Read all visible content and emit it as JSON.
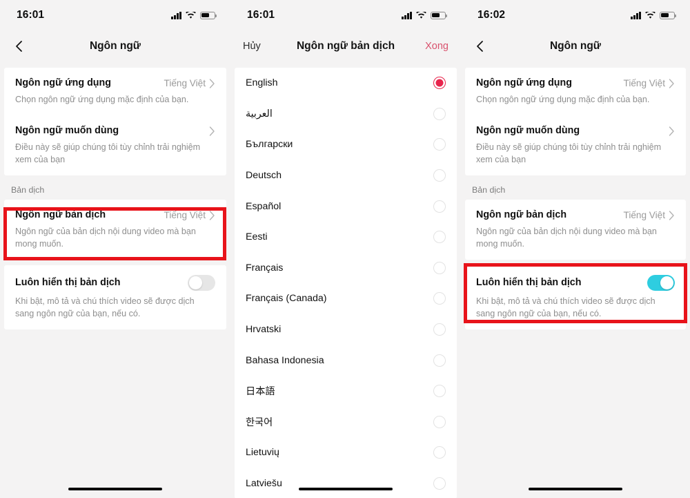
{
  "accent": {
    "red_highlight": "#e8131a",
    "selected_radio": "#e8244c",
    "done_button": "#d9536e",
    "toggle_on": "#2ecde0",
    "toggle_off": "#e6e6e6",
    "background": "#f4f3f3",
    "card": "#ffffff"
  },
  "panel1": {
    "status": {
      "time": "16:01",
      "signal_icon": "cellular-signal-icon",
      "wifi_icon": "wifi-icon",
      "battery_icon": "battery-icon"
    },
    "nav": {
      "back_icon": "chevron-left-icon",
      "title": "Ngôn ngữ"
    },
    "rows": [
      {
        "title": "Ngôn ngữ ứng dụng",
        "value": "Tiếng Việt",
        "desc": "Chọn ngôn ngữ ứng dụng mặc định của bạn.",
        "chevron": "chevron-right-icon"
      },
      {
        "title": "Ngôn ngữ muốn dùng",
        "value": "",
        "desc": "Điều này sẽ giúp chúng tôi tùy chỉnh trải nghiệm xem của bạn",
        "chevron": "chevron-right-icon"
      }
    ],
    "section_label": "Bản dịch",
    "translate_rows": [
      {
        "title": "Ngôn ngữ bản dịch",
        "value": "Tiếng Việt",
        "desc": "Ngôn ngữ của bản dịch nội dung video mà bạn mong muốn.",
        "chevron": "chevron-right-icon"
      }
    ],
    "toggle_row": {
      "title": "Luôn hiển thị bản dịch",
      "desc": "Khi bật, mô tả và chú thích video sẽ được dịch sang ngôn ngữ của bạn, nếu có.",
      "state": "off"
    }
  },
  "panel2": {
    "status": {
      "time": "16:01",
      "signal_icon": "cellular-signal-icon",
      "wifi_icon": "wifi-icon",
      "battery_icon": "battery-icon"
    },
    "nav": {
      "cancel_label": "Hủy",
      "title": "Ngôn ngữ bản dịch",
      "done_label": "Xong"
    },
    "languages": [
      {
        "name": "English",
        "selected": true,
        "rtl": false
      },
      {
        "name": "العربية",
        "selected": false,
        "rtl": true
      },
      {
        "name": "Български",
        "selected": false,
        "rtl": false
      },
      {
        "name": "Deutsch",
        "selected": false,
        "rtl": false
      },
      {
        "name": "Español",
        "selected": false,
        "rtl": false
      },
      {
        "name": "Eesti",
        "selected": false,
        "rtl": false
      },
      {
        "name": "Français",
        "selected": false,
        "rtl": false
      },
      {
        "name": "Français (Canada)",
        "selected": false,
        "rtl": false
      },
      {
        "name": "Hrvatski",
        "selected": false,
        "rtl": false
      },
      {
        "name": "Bahasa Indonesia",
        "selected": false,
        "rtl": false
      },
      {
        "name": "日本語",
        "selected": false,
        "rtl": false
      },
      {
        "name": "한국어",
        "selected": false,
        "rtl": false
      },
      {
        "name": "Lietuvių",
        "selected": false,
        "rtl": false
      },
      {
        "name": "Latviešu",
        "selected": false,
        "rtl": false
      }
    ]
  },
  "panel3": {
    "status": {
      "time": "16:02",
      "signal_icon": "cellular-signal-icon",
      "wifi_icon": "wifi-icon",
      "battery_icon": "battery-icon"
    },
    "nav": {
      "back_icon": "chevron-left-icon",
      "title": "Ngôn ngữ"
    },
    "rows": [
      {
        "title": "Ngôn ngữ ứng dụng",
        "value": "Tiếng Việt",
        "desc": "Chọn ngôn ngữ ứng dụng mặc định của bạn.",
        "chevron": "chevron-right-icon"
      },
      {
        "title": "Ngôn ngữ muốn dùng",
        "value": "",
        "desc": "Điều này sẽ giúp chúng tôi tùy chỉnh trải nghiệm xem của bạn",
        "chevron": "chevron-right-icon"
      }
    ],
    "section_label": "Bản dịch",
    "translate_rows": [
      {
        "title": "Ngôn ngữ bản dịch",
        "value": "Tiếng Việt",
        "desc": "Ngôn ngữ của bản dịch nội dung video mà bạn mong muốn.",
        "chevron": "chevron-right-icon"
      }
    ],
    "toggle_row": {
      "title": "Luôn hiển thị bản dịch",
      "desc": "Khi bật, mô tả và chú thích video sẽ được dịch sang ngôn ngữ của bạn, nếu có.",
      "state": "on"
    }
  }
}
